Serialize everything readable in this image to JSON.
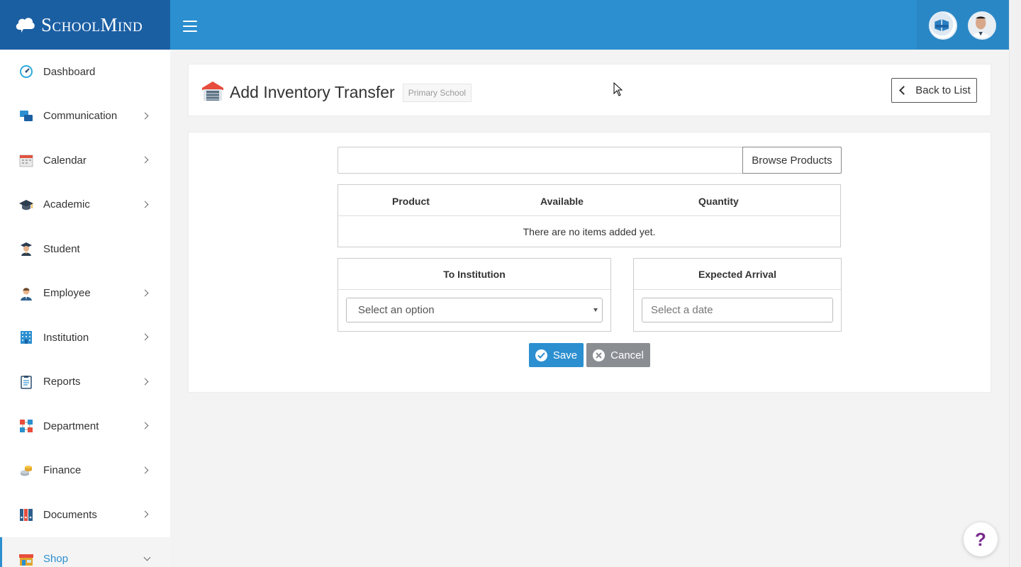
{
  "app": {
    "name": "SchoolMind",
    "brand_color": "#2b8fd0",
    "brand_dark": "#1b5fa3"
  },
  "sidebar": {
    "items": [
      {
        "label": "Dashboard",
        "icon": "dashboard-icon",
        "has_children": false
      },
      {
        "label": "Communication",
        "icon": "chat-bubbles-icon",
        "has_children": true
      },
      {
        "label": "Calendar",
        "icon": "calendar-icon",
        "has_children": true
      },
      {
        "label": "Academic",
        "icon": "graduation-cap-icon",
        "has_children": true
      },
      {
        "label": "Student",
        "icon": "student-icon",
        "has_children": false
      },
      {
        "label": "Employee",
        "icon": "employee-icon",
        "has_children": true
      },
      {
        "label": "Institution",
        "icon": "building-icon",
        "has_children": true
      },
      {
        "label": "Reports",
        "icon": "clipboard-icon",
        "has_children": true
      },
      {
        "label": "Department",
        "icon": "org-chart-icon",
        "has_children": true
      },
      {
        "label": "Finance",
        "icon": "coins-icon",
        "has_children": true
      },
      {
        "label": "Documents",
        "icon": "binders-icon",
        "has_children": true
      },
      {
        "label": "Shop",
        "icon": "shop-icon",
        "has_children": true,
        "active": true
      }
    ]
  },
  "header": {
    "title": "Add Inventory Transfer",
    "badge": "Primary School",
    "back_label": "Back to List"
  },
  "form": {
    "search_placeholder": "",
    "browse_label": "Browse Products",
    "table": {
      "columns": [
        "Product",
        "Available",
        "Quantity"
      ],
      "empty_text": "There are no items added yet."
    },
    "institution": {
      "heading": "To Institution",
      "selected": "Select an option"
    },
    "arrival": {
      "heading": "Expected Arrival",
      "placeholder": "Select a date"
    },
    "save_label": "Save",
    "cancel_label": "Cancel"
  },
  "help": {
    "label": "?"
  }
}
